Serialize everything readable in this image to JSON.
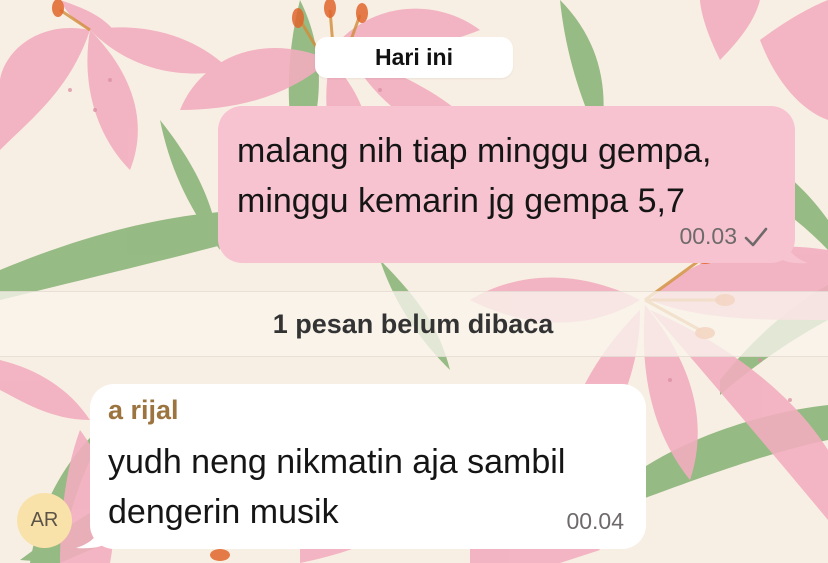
{
  "chat": {
    "date_label": "Hari ini",
    "outgoing": {
      "text": "malang nih tiap minggu gempa,\nminggu kemarin jg gempa 5,7",
      "time": "00.03",
      "status_icon": "single-check-icon"
    },
    "unread_divider": "1 pesan belum dibaca",
    "incoming": {
      "sender": "a rijal",
      "text": "yudh neng nikmatin aja sambil\ndengerin musik",
      "time": "00.04",
      "avatar_initials": "AR"
    }
  },
  "colors": {
    "wallpaper_bg": "#f8efe4",
    "outgoing_bubble": "#f7c3d1",
    "incoming_bubble": "#ffffff",
    "sender_name": "#9c7440",
    "avatar_bg": "#f9e2a9",
    "lily_petal": "#f2aebf",
    "leaf": "#7fae6a"
  }
}
